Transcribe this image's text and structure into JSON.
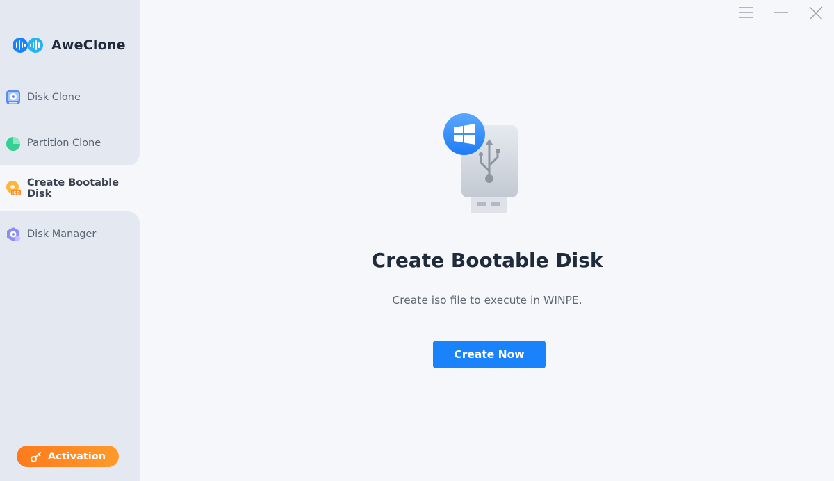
{
  "app": {
    "name": "AweClone"
  },
  "sidebar": {
    "items": [
      {
        "id": "disk-clone",
        "label": "Disk Clone",
        "icon": "disk-clone-icon",
        "active": false
      },
      {
        "id": "partition-clone",
        "label": "Partition Clone",
        "icon": "pie-chart-icon",
        "active": false
      },
      {
        "id": "create-bootable-disk",
        "label": "Create Bootable Disk",
        "icon": "iso-disc-icon",
        "active": true
      },
      {
        "id": "disk-manager",
        "label": "Disk Manager",
        "icon": "disk-manager-icon",
        "active": false
      }
    ],
    "activation_label": "Activation"
  },
  "window_controls": [
    "menu-icon",
    "minimize-icon",
    "close-icon"
  ],
  "main": {
    "title": "Create Bootable Disk",
    "subtitle": "Create iso file to execute in WINPE.",
    "button_label": "Create Now",
    "hero_icon": "usb-windows-icon"
  },
  "colors": {
    "accent": "#1a82fb",
    "activation": "#ff8a24",
    "sidebar_bg": "#e4e9f1",
    "main_bg": "#f5f7fb"
  }
}
